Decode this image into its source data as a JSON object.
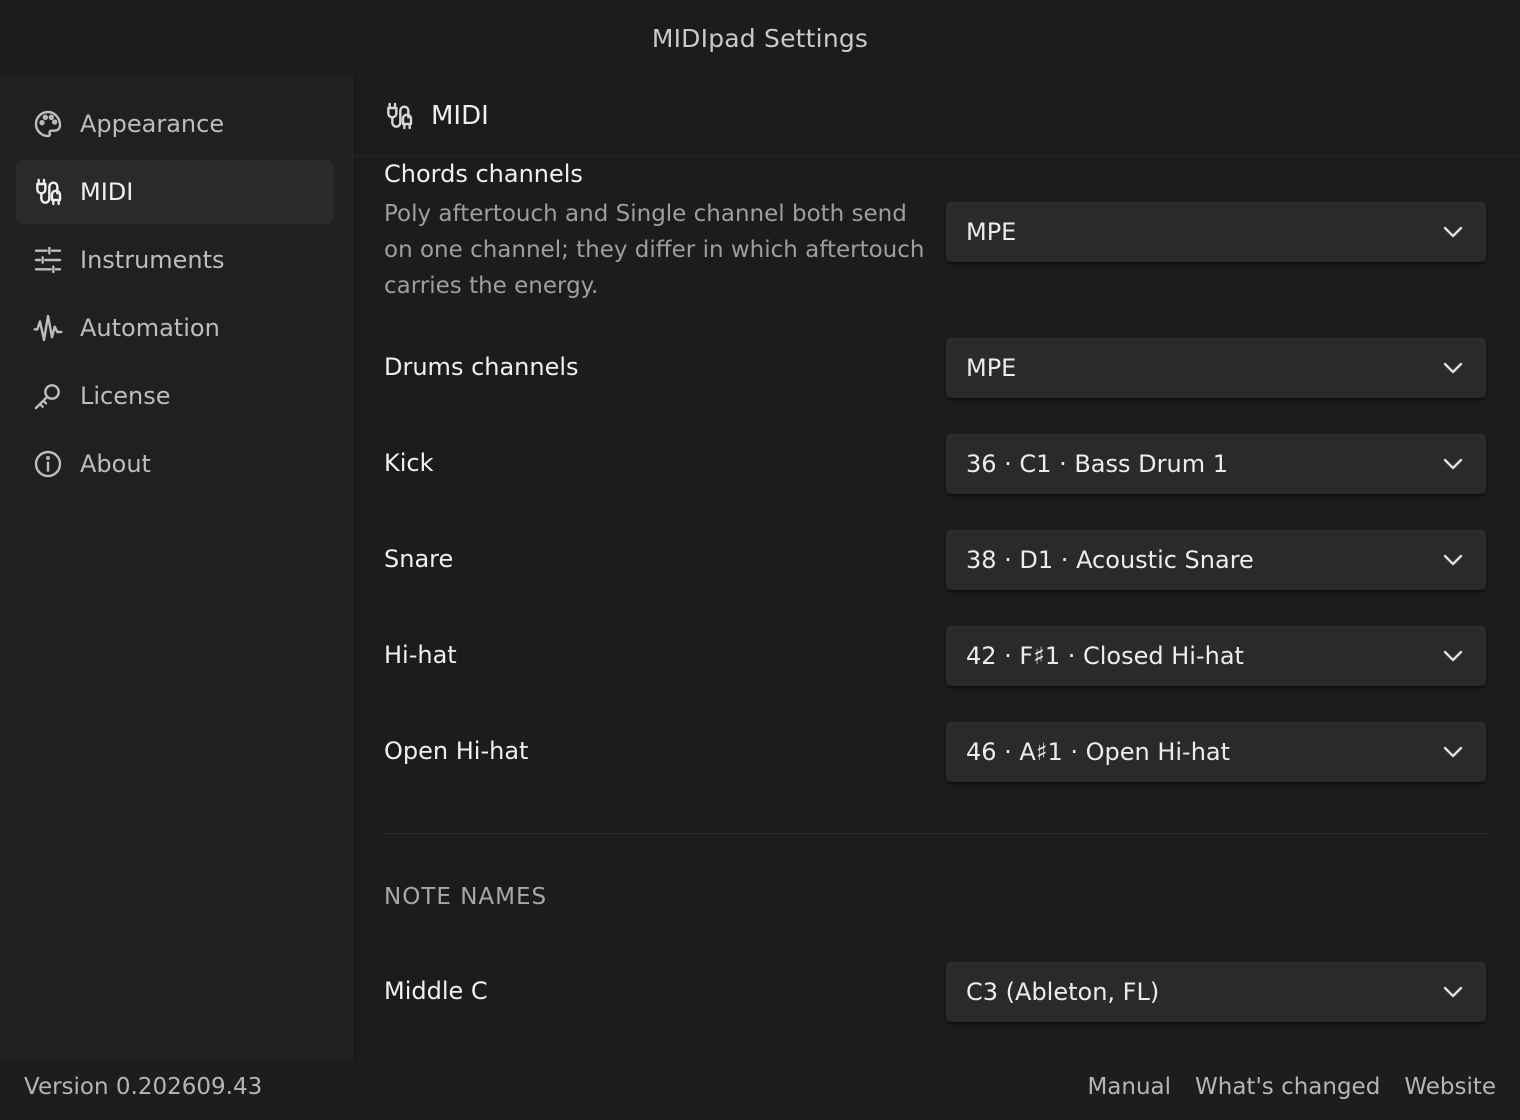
{
  "window": {
    "title": "MIDIpad Settings"
  },
  "sidebar": {
    "items": [
      {
        "label": "Appearance",
        "icon": "palette-icon"
      },
      {
        "label": "MIDI",
        "icon": "midi-cable-icon",
        "active": true
      },
      {
        "label": "Instruments",
        "icon": "sliders-icon"
      },
      {
        "label": "Automation",
        "icon": "waveform-icon"
      },
      {
        "label": "License",
        "icon": "key-icon"
      },
      {
        "label": "About",
        "icon": "info-icon"
      }
    ]
  },
  "main": {
    "section_title": "MIDI",
    "section_icon": "midi-cable-icon",
    "chords": {
      "label": "Chords channels",
      "description": "Poly aftertouch and Single channel both send on one channel; they differ in which aftertouch carries the energy.",
      "value": "MPE"
    },
    "drums": {
      "label": "Drums channels",
      "value": "MPE"
    },
    "kick": {
      "label": "Kick",
      "value": "36 · C1 · Bass Drum 1"
    },
    "snare": {
      "label": "Snare",
      "value": "38 · D1 · Acoustic Snare"
    },
    "hihat": {
      "label": "Hi-hat",
      "value": "42 · F♯1 · Closed Hi-hat"
    },
    "open_hihat": {
      "label": "Open Hi-hat",
      "value": "46 · A♯1 · Open Hi-hat"
    },
    "note_names": {
      "group_title": "NOTE NAMES",
      "middle_c": {
        "label": "Middle C",
        "value": "C3 (Ableton, FL)"
      }
    }
  },
  "footer": {
    "version": "Version 0.202609.43",
    "links": {
      "manual": "Manual",
      "whats_changed": "What's changed",
      "website": "Website"
    }
  },
  "colors": {
    "background": "#1f1f1f",
    "active_item": "#2a2a2a",
    "select": "#2a2a2a",
    "text": "#f0f0f0"
  }
}
